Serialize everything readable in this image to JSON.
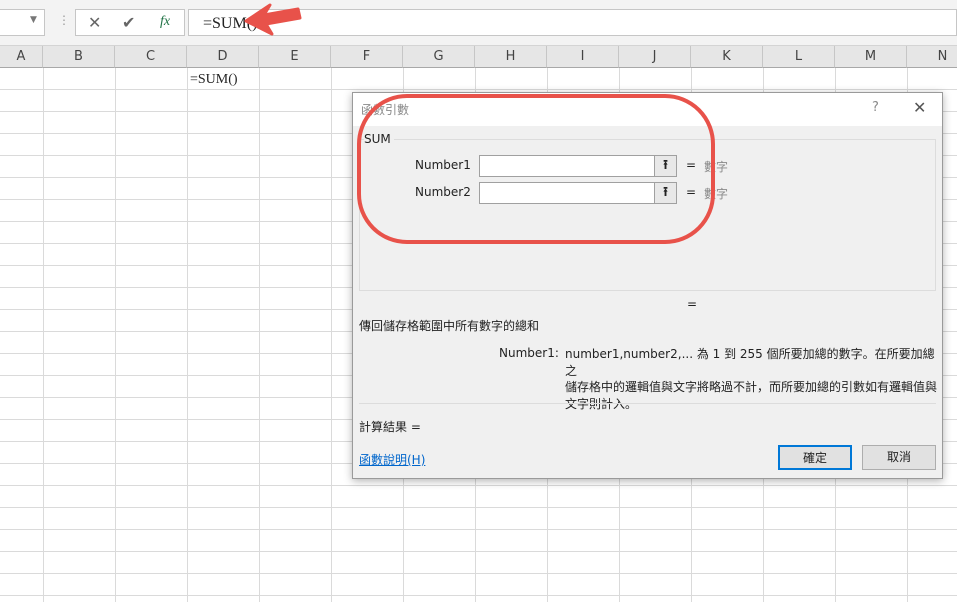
{
  "formula_bar": {
    "formula": "=SUM()",
    "cancel_icon": "x-icon",
    "enter_icon": "check-icon",
    "fx_label": "fx"
  },
  "columns": [
    "A",
    "B",
    "C",
    "D",
    "E",
    "F",
    "G",
    "H",
    "I",
    "J",
    "K",
    "L",
    "M",
    "N"
  ],
  "cells": {
    "D1": "=SUM()"
  },
  "dialog": {
    "title": "函數引數",
    "help_glyph": "?",
    "function_name": "SUM",
    "args": [
      {
        "label": "Number1",
        "value": "",
        "eq": "=",
        "hint": "數字"
      },
      {
        "label": "Number2",
        "value": "",
        "eq": "=",
        "hint": "數字"
      }
    ],
    "result_eq": "=",
    "description": "傳回儲存格範圍中所有數字的總和",
    "arg_name": "Number1:",
    "arg_desc": [
      "number1,number2,... 為 1 到 255 個所要加總的數字。在所要加總之",
      "儲存格中的邏輯值與文字將略過不計，而所要加總的引數如有邏輯值與",
      "文字則計入。"
    ],
    "calc_result": "計算結果 =",
    "help_link": "函數說明(H)",
    "ok": "確定",
    "cancel": "取消"
  },
  "annotation_color": "#e8524a"
}
